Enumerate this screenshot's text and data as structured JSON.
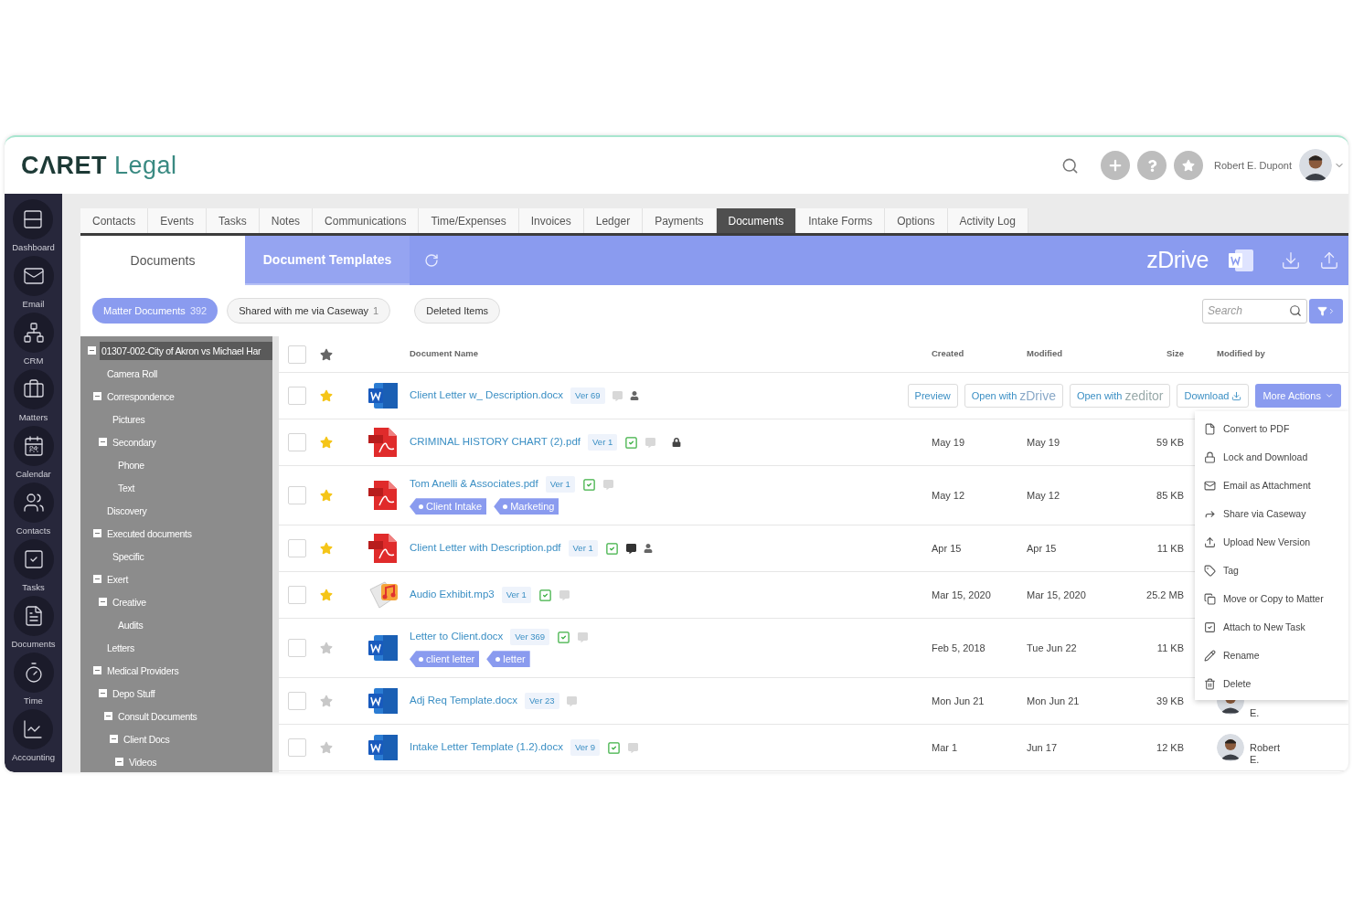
{
  "header": {
    "logo": {
      "mark": "CΛRET",
      "word": "Legal"
    },
    "user_name": "Robert E. Dupont"
  },
  "sidebar": {
    "items": [
      {
        "label": "Dashboard"
      },
      {
        "label": "Email"
      },
      {
        "label": "CRM"
      },
      {
        "label": "Matters"
      },
      {
        "label": "Calendar",
        "icon_text": "24"
      },
      {
        "label": "Contacts"
      },
      {
        "label": "Tasks"
      },
      {
        "label": "Documents"
      },
      {
        "label": "Time"
      },
      {
        "label": "Accounting"
      }
    ]
  },
  "tabs": [
    {
      "label": "Contacts",
      "selected": false
    },
    {
      "label": "Events",
      "selected": false
    },
    {
      "label": "Tasks",
      "selected": false
    },
    {
      "label": "Notes",
      "selected": false
    },
    {
      "label": "Communications",
      "selected": false
    },
    {
      "label": "Time/Expenses",
      "selected": false
    },
    {
      "label": "Invoices",
      "selected": false
    },
    {
      "label": "Ledger",
      "selected": false
    },
    {
      "label": "Payments",
      "selected": false
    },
    {
      "label": "Documents",
      "selected": true
    },
    {
      "label": "Intake Forms",
      "selected": false
    },
    {
      "label": "Options",
      "selected": false
    },
    {
      "label": "Activity Log",
      "selected": false
    }
  ],
  "banner": {
    "tabs": [
      {
        "label": "Documents",
        "selected": true
      },
      {
        "label": "Document Templates",
        "selected": false
      }
    ],
    "brand": "zDrive"
  },
  "filters": [
    {
      "label": "Matter Documents",
      "count": "392",
      "selected": true
    },
    {
      "label": "Shared with me via Caseway",
      "count": "1",
      "selected": false
    },
    {
      "label": "Deleted Items",
      "selected": false
    }
  ],
  "search": {
    "placeholder": "Search"
  },
  "tree": [
    {
      "label": "01307-002-City of Akron vs Michael Har",
      "selected": true,
      "expanded": true,
      "children": [
        {
          "label": "Camera Roll",
          "selected": false
        },
        {
          "label": "Correspondence",
          "selected": false,
          "expanded": true,
          "children": [
            {
              "label": "Pictures",
              "selected": false
            },
            {
              "label": "Secondary",
              "selected": false,
              "expanded": true,
              "children": [
                {
                  "label": "Phone",
                  "selected": false
                },
                {
                  "label": "Text",
                  "selected": false
                }
              ]
            }
          ]
        },
        {
          "label": "Discovery",
          "selected": false
        },
        {
          "label": "Executed documents",
          "selected": false,
          "expanded": true,
          "children": [
            {
              "label": "Specific",
              "selected": false
            }
          ]
        },
        {
          "label": "Exert",
          "selected": false,
          "expanded": true,
          "children": [
            {
              "label": "Creative",
              "selected": false,
              "expanded": true,
              "children": [
                {
                  "label": "Audits",
                  "selected": false
                }
              ]
            }
          ]
        },
        {
          "label": "Letters",
          "selected": false
        },
        {
          "label": "Medical Providers",
          "selected": false,
          "expanded": true,
          "children": [
            {
              "label": "Depo Stuff",
              "selected": false,
              "expanded": true,
              "children": [
                {
                  "label": "Consult Documents",
                  "selected": false,
                  "expanded": true,
                  "children": [
                    {
                      "label": "Client Docs",
                      "selected": false,
                      "expanded": true,
                      "children": [
                        {
                          "label": "Videos",
                          "selected": false,
                          "expanded": true
                        }
                      ]
                    }
                  ]
                }
              ]
            }
          ]
        }
      ]
    }
  ],
  "table": {
    "all_selected": false,
    "columns": [
      "Document Name",
      "Created",
      "Modified",
      "Size",
      "Modified by"
    ],
    "rows": [
      {
        "kind": "word",
        "selected": false,
        "starred": true,
        "name": "Client Letter w_ Description.docx",
        "version": "Ver 69",
        "checked": false,
        "has_comments": false,
        "shared": true,
        "locked": false,
        "actions": [
          {
            "kind": "plain",
            "label": "Preview"
          },
          {
            "kind": "brand",
            "label": "Open with",
            "brand": "zDrive"
          },
          {
            "kind": "brand",
            "label": "Open with",
            "brand": "zeditor"
          },
          {
            "kind": "download",
            "label": "Download"
          },
          {
            "kind": "menu",
            "label": "More Actions"
          }
        ]
      },
      {
        "kind": "pdf",
        "selected": false,
        "starred": true,
        "name": "CRIMINAL HISTORY CHART (2).pdf",
        "version": "Ver 1",
        "checked": true,
        "has_comments": false,
        "shared": false,
        "locked": true,
        "created": "May 19",
        "modified": "May 19",
        "size": "59 KB"
      },
      {
        "kind": "pdf",
        "selected": false,
        "starred": true,
        "name": "Tom Anelli & Associates.pdf",
        "version": "Ver 1",
        "checked": true,
        "has_comments": false,
        "shared": false,
        "locked": false,
        "tags": [
          "Client Intake",
          "Marketing"
        ],
        "created": "May 12",
        "modified": "May 12",
        "size": "85 KB"
      },
      {
        "kind": "pdf",
        "selected": false,
        "starred": true,
        "name": "Client Letter with Description.pdf",
        "version": "Ver 1",
        "checked": true,
        "has_comments": true,
        "shared": true,
        "locked": false,
        "created": "Apr 15",
        "modified": "Apr 15",
        "size": "11 KB"
      },
      {
        "kind": "audio",
        "selected": false,
        "starred": true,
        "name": "Audio Exhibit.mp3",
        "version": "Ver 1",
        "checked": true,
        "has_comments": false,
        "shared": false,
        "locked": false,
        "created": "Mar 15, 2020",
        "modified": "Mar 15, 2020",
        "size": "25.2 MB"
      },
      {
        "kind": "word",
        "selected": false,
        "starred": false,
        "name": "Letter to Client.docx",
        "version": "Ver 369",
        "checked": true,
        "has_comments": false,
        "shared": false,
        "locked": false,
        "tags": [
          "client letter",
          "letter"
        ],
        "created": "Feb 5, 2018",
        "modified": "Tue Jun 22",
        "size": "11 KB"
      },
      {
        "kind": "word",
        "selected": false,
        "starred": false,
        "name": "Adj Req Template.docx",
        "version": "Ver 23",
        "checked": false,
        "has_comments": false,
        "shared": false,
        "locked": false,
        "created": "Mon Jun 21",
        "modified": "Mon Jun 21",
        "size": "39 KB",
        "modified_by": "E."
      },
      {
        "kind": "word",
        "selected": false,
        "starred": false,
        "name": "Intake Letter Template (1.2).docx",
        "version": "Ver 9",
        "checked": true,
        "has_comments": false,
        "shared": false,
        "locked": false,
        "created": "Mar 1",
        "modified": "Jun 17",
        "size": "12 KB",
        "modified_by": "Robert E."
      }
    ]
  },
  "menu": {
    "items": [
      {
        "label": "Convert to PDF"
      },
      {
        "label": "Lock and Download"
      },
      {
        "label": "Email as Attachment"
      },
      {
        "label": "Share via Caseway"
      },
      {
        "label": "Upload New Version"
      },
      {
        "label": "Tag"
      },
      {
        "label": "Move or Copy to Matter"
      },
      {
        "label": "Attach to New Task"
      },
      {
        "label": "Rename"
      },
      {
        "label": "Delete"
      }
    ]
  }
}
